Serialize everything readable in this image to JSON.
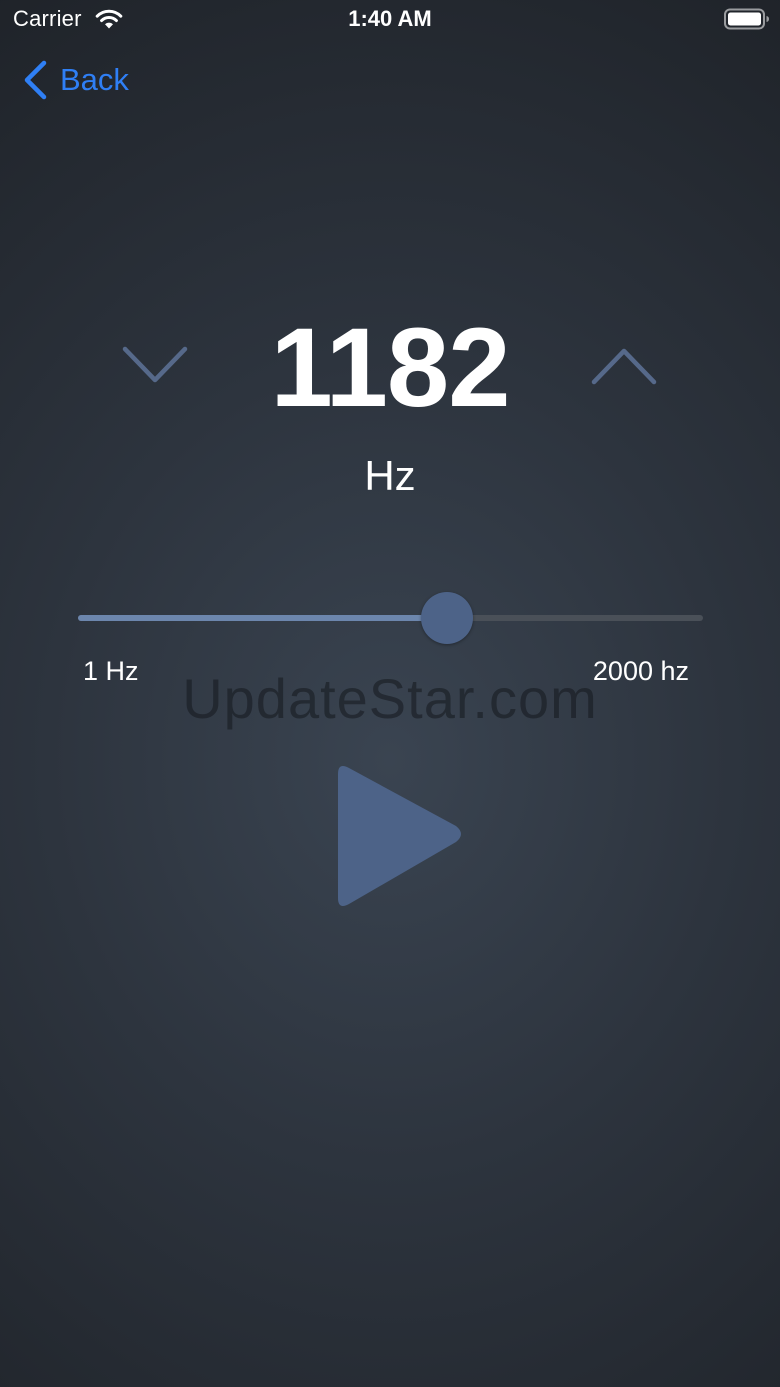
{
  "status_bar": {
    "carrier": "Carrier",
    "time": "1:40 AM"
  },
  "nav": {
    "back_label": "Back"
  },
  "frequency": {
    "value": "1182",
    "unit": "Hz"
  },
  "slider": {
    "min_label": "1 Hz",
    "max_label": "2000 hz",
    "min": 1,
    "max": 2000,
    "current": 1182
  },
  "watermark": "UpdateStar.com",
  "colors": {
    "accent": "#2f7ff5",
    "control": "#4d6388",
    "chevron": "#56698a"
  },
  "icons": {
    "down": "chevron-down-icon",
    "up": "chevron-up-icon",
    "play": "play-icon"
  }
}
